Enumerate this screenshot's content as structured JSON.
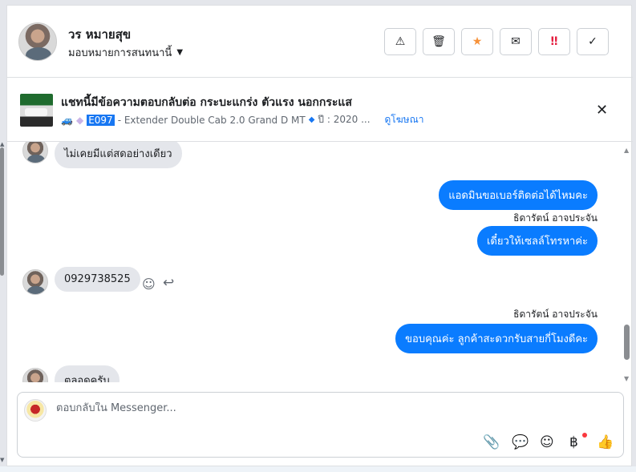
{
  "header": {
    "contact_name": "วร หมายสุข",
    "assign_label": "มอบหมายการสนทนานี้",
    "buttons": {
      "alert": "⚠",
      "delete": "🗑",
      "star": "★",
      "mail": "✉",
      "urgent": "‼",
      "done": "✓"
    }
  },
  "ad": {
    "title": "แชทนี้มีข้อความตอบกลับต่อ กระบะแกร่ง ตัวแรง นอกกระแส",
    "code": "E097",
    "detail": "- Extender Double Cab 2.0 Grand D MT",
    "year": "ปี : 2020 ...",
    "view_link": "ดูโฆษณา"
  },
  "messages": {
    "in_1": "ไม่เคยมีแต่สดอย่างเดียว",
    "out_1": "แอดมินขอเบอร์ติดต่อได้ไหมคะ",
    "sender_1": "ธิดารัตน์ อาจประจัน",
    "out_2": "เดี๋ยวให้เซลล์โทรหาค่ะ",
    "in_2": "0929738525",
    "sender_2": "ธิดารัตน์ อาจประจัน",
    "out_3": "ขอบคุณค่ะ ลูกค้าสะดวกรับสายกี่โมงดีคะ",
    "in_3": "ตลอดครับ"
  },
  "composer": {
    "placeholder": "ตอบกลับใน Messenger..."
  },
  "colors": {
    "outgoing_bubble": "#0a7cff",
    "incoming_bubble": "#e4e6eb",
    "star": "#f7923a",
    "urgent": "#e41e3f"
  }
}
